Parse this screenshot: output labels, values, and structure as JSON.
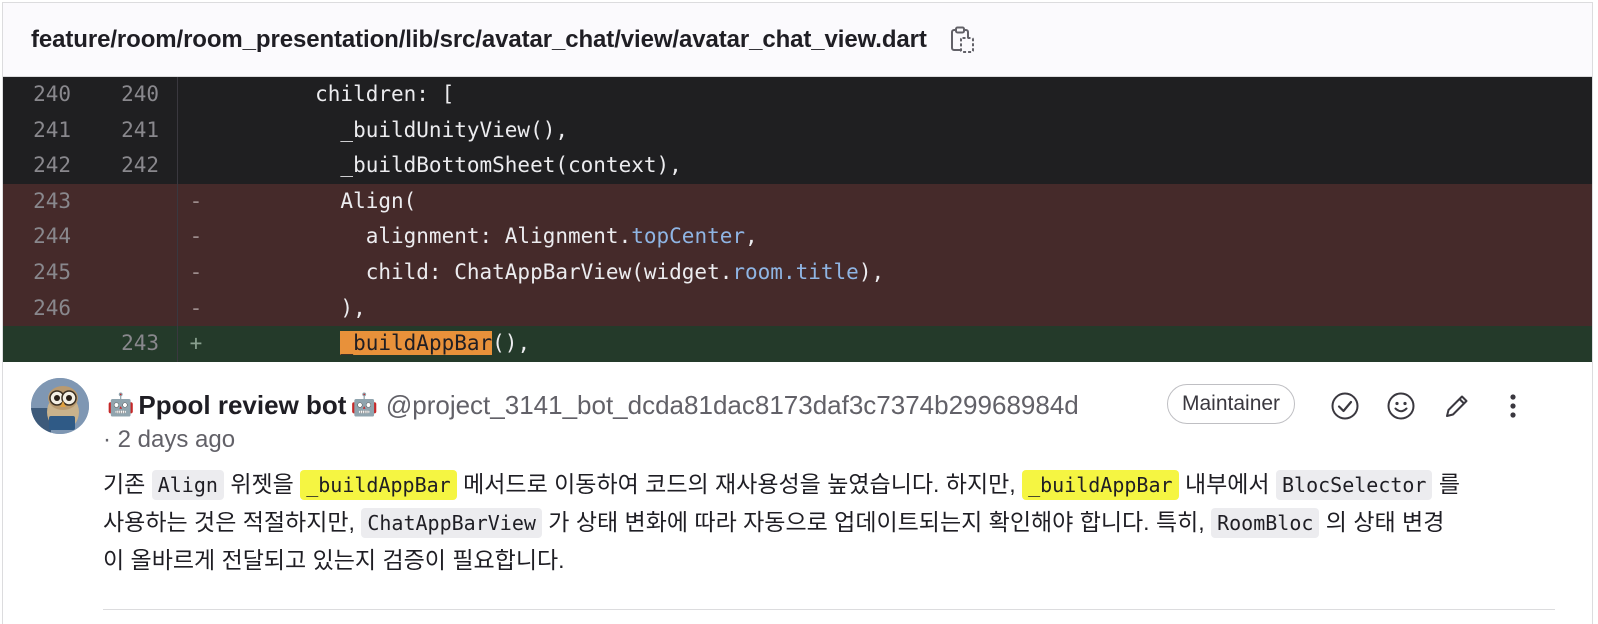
{
  "file": {
    "path": "feature/room/room_presentation/lib/src/avatar_chat/view/avatar_chat_view.dart",
    "copy_icon": "clipboard-copy-icon"
  },
  "diff": {
    "rows": [
      {
        "type": "ctx",
        "old": "240",
        "new": "240",
        "marker": "",
        "code": "        children: ["
      },
      {
        "type": "ctx",
        "old": "241",
        "new": "241",
        "marker": "",
        "code": "          _buildUnityView(),"
      },
      {
        "type": "ctx",
        "old": "242",
        "new": "242",
        "marker": "",
        "code": "          _buildBottomSheet(context),"
      },
      {
        "type": "del",
        "old": "243",
        "new": "",
        "marker": "-",
        "code": "          Align("
      },
      {
        "type": "del",
        "old": "244",
        "new": "",
        "marker": "-",
        "code_pre": "            alignment: Alignment.",
        "code_prop": "topCenter",
        "code_post": ","
      },
      {
        "type": "del",
        "old": "245",
        "new": "",
        "marker": "-",
        "code_pre": "            child: ChatAppBarView(widget.",
        "code_prop": "room.title",
        "code_post": "),"
      },
      {
        "type": "del",
        "old": "246",
        "new": "",
        "marker": "-",
        "code": "          ),"
      },
      {
        "type": "add",
        "old": "",
        "new": "243",
        "marker": "+",
        "code_pre": "          ",
        "code_hl": "_buildAppBar",
        "code_post": "(),"
      }
    ]
  },
  "comment": {
    "avatar_icon": "owl-avatar",
    "bot_emoji": "🤖",
    "author": "Ppool review bot",
    "handle": "@project_3141_bot_dcda81dac8173daf3c7374b29968984d",
    "time": "· 2 days ago",
    "role": "Maintainer",
    "actions": {
      "resolve": "check-circle-icon",
      "react": "smiley-icon",
      "edit": "pencil-icon",
      "more": "more-vertical-icon"
    },
    "body": {
      "t1": "기존 ",
      "c1": "Align",
      "t2": " 위젯을 ",
      "c2": "_buildAppBar",
      "t3": " 메서드로 이동하여 코드의 재사용성을 높였습니다. 하지만, ",
      "c3": "_buildAppBar",
      "t4": " 내부에서 ",
      "c4": "BlocSelector",
      "t5": " 를 사용하는 것은 적절하지만, ",
      "c5": "ChatAppBarView",
      "t6": " 가 상태 변화에 따라 자동으로 업데이트되는지 확인해야 합니다. 특히, ",
      "c6": "RoomBloc",
      "t7": " 의 상태 변경이 올바르게 전달되고 있는지 검증이 필요합니다."
    }
  }
}
